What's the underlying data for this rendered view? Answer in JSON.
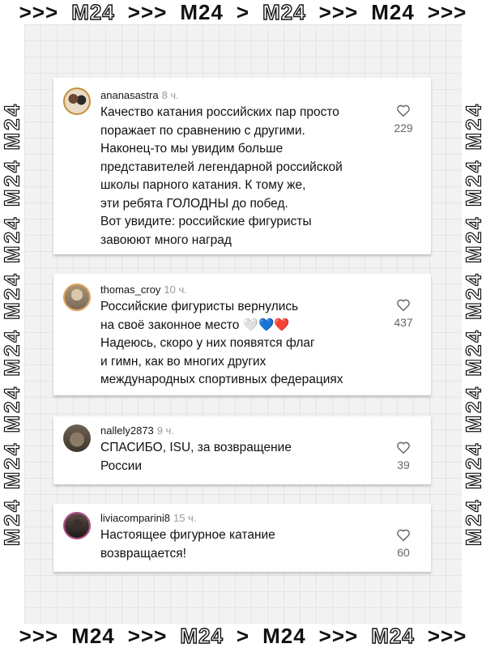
{
  "banner": {
    "top": [
      ">>>",
      "M24",
      ">>>",
      "M24",
      ">",
      "M24",
      ">>>",
      "M24",
      ">>>"
    ],
    "bottom": [
      ">>>",
      "M24",
      ">>>",
      "M24",
      ">",
      "M24",
      ">>>",
      "M24",
      ">>>"
    ],
    "side": "M24 M24 M24 M24 M24 M24 M24 M24"
  },
  "comments": [
    {
      "username": "ananasastra",
      "time": "8 ч.",
      "lines": [
        "Качество катания российских пар просто",
        "поражает по сравнению с другими.",
        "Наконец-то мы увидим больше",
        "представителей легендарной российской",
        "школы парного катания. К тому же,",
        "эти ребята ГОЛОДНЫ до побед.",
        "Вот увидите: российские фигуристы",
        "завоюют много наград"
      ],
      "likes": "229"
    },
    {
      "username": "thomas_croy",
      "time": "10 ч.",
      "lines": [
        "Российские фигуристы вернулись",
        "на своё законное место 🤍💙❤️",
        "Надеюсь, скоро у них появятся флаг",
        "и гимн, как во многих других",
        "международных спортивных федерациях"
      ],
      "likes": "437"
    },
    {
      "username": "nallely2873",
      "time": "9 ч.",
      "lines": [
        "СПАСИБО, ISU, за возвращение",
        "России"
      ],
      "likes": "39"
    },
    {
      "username": "liviacomparini8",
      "time": "15 ч.",
      "lines": [
        "Настоящее фигурное катание",
        "возвращается!"
      ],
      "likes": "60"
    }
  ]
}
